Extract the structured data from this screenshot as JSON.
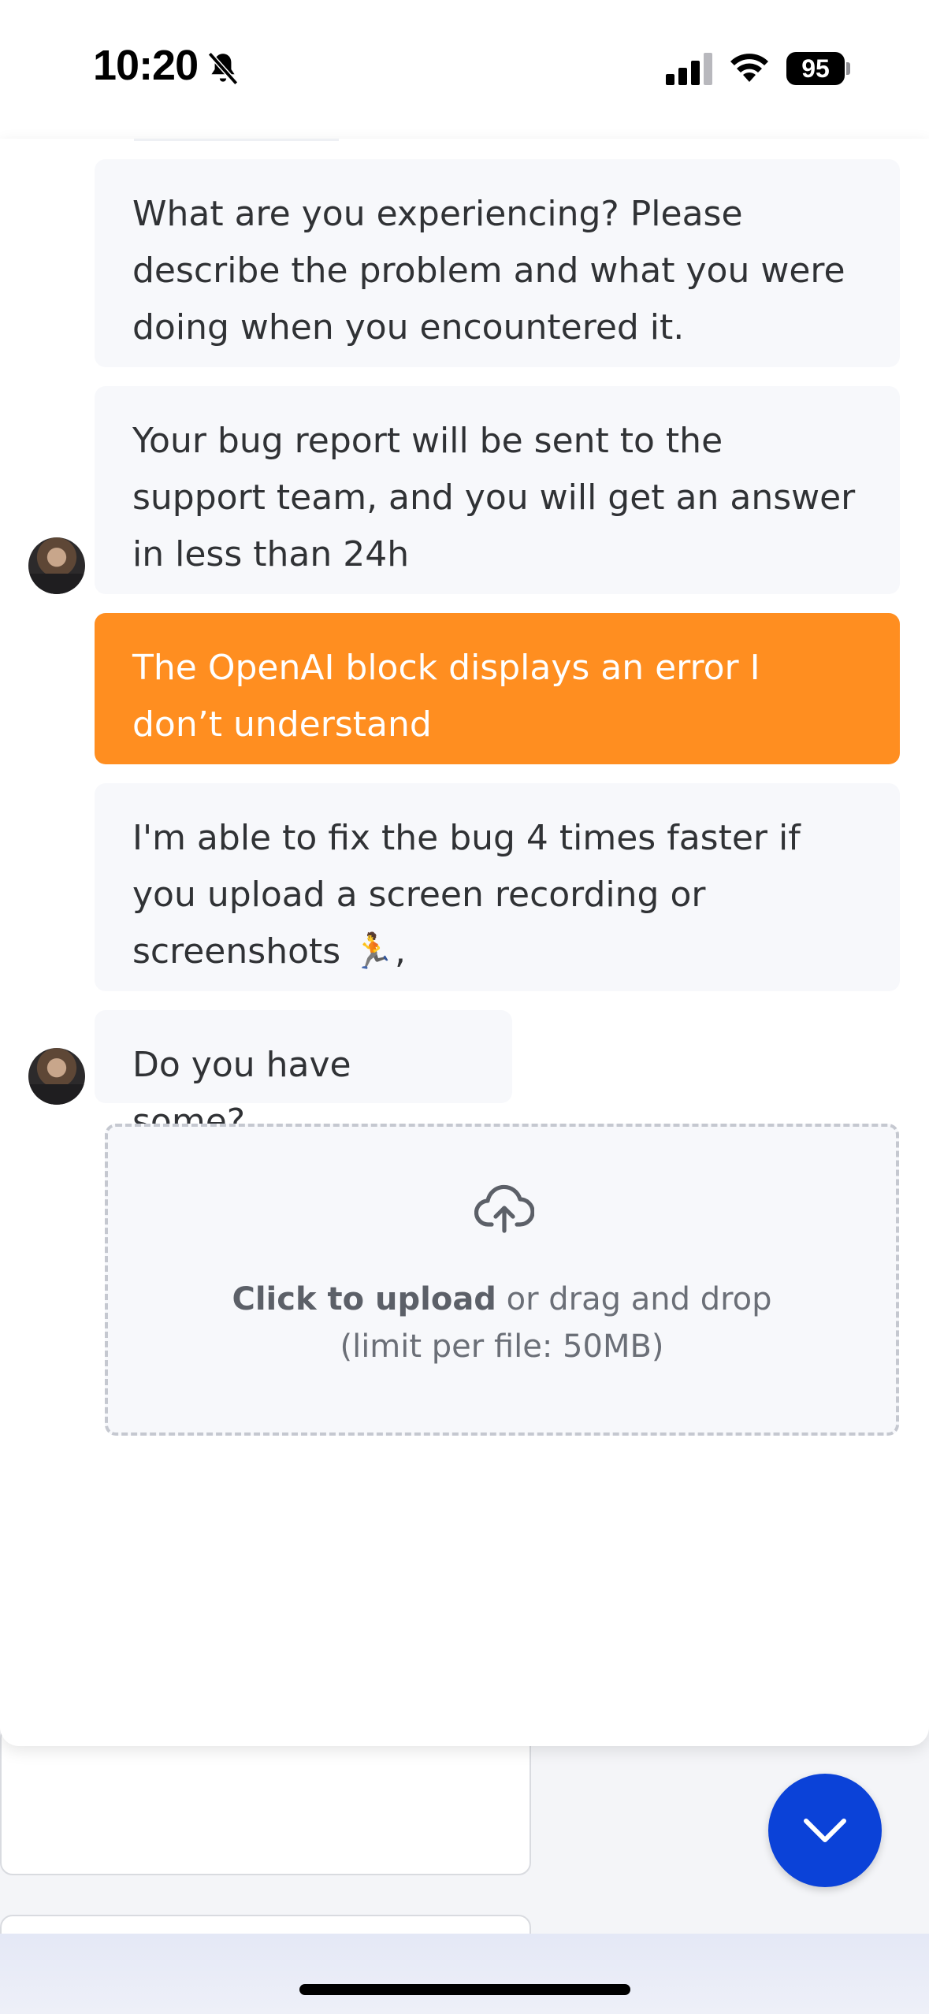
{
  "status_bar": {
    "time": "10:20",
    "battery": "95",
    "icons": [
      "bell-slash-icon",
      "cellular-signal-icon",
      "wifi-icon",
      "battery-icon"
    ]
  },
  "chat": {
    "messages": [
      {
        "role": "bot",
        "lines": [
          "What are you experiencing? Please",
          "describe the problem and what you were",
          "doing when you encountered it."
        ]
      },
      {
        "role": "bot",
        "lines": [
          "Your bug report will be sent to the",
          "support team, and you will get an answer",
          "in less than 24h"
        ]
      },
      {
        "role": "user",
        "lines": [
          "The OpenAI block displays an error I",
          "don’t understand"
        ]
      },
      {
        "role": "bot",
        "lines": [
          "I'm able to fix the bug 4 times faster if",
          "you upload a screen recording or",
          "screenshots 🏃,"
        ]
      },
      {
        "role": "bot",
        "lines": [
          "Do you have some?"
        ]
      }
    ],
    "upload": {
      "strong": "Click to upload",
      "rest": " or drag and drop",
      "limit": "(limit per file: 50MB)"
    }
  },
  "colors": {
    "user_bubble": "#ff8e20",
    "bot_bubble": "#f7f8fb",
    "fab": "#0b42d8"
  }
}
